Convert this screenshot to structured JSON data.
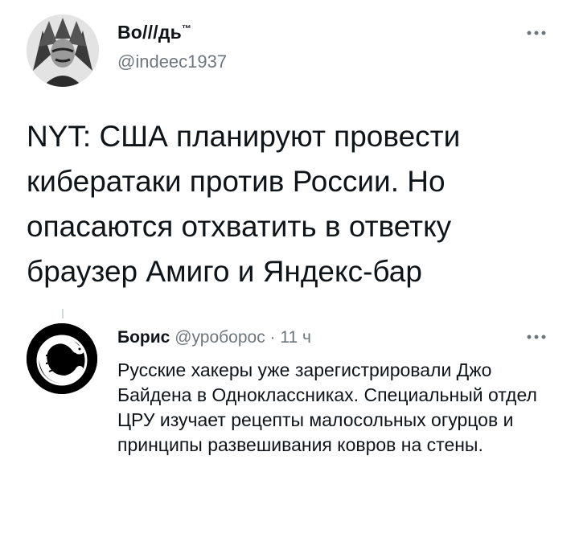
{
  "tweet": {
    "author_name": "Во///дь",
    "author_trademark": "™",
    "author_handle": "@indeec1937",
    "more_icon": "more-horizontal-icon",
    "text": "NYT: США планируют провести кибератаки против России. Но опасаются отхватить в ответку браузер Амиго и Яндекс-бар"
  },
  "reply": {
    "author_name": "Борис",
    "author_handle": "@уроборос",
    "separator": "·",
    "time": "11 ч",
    "more_icon": "more-horizontal-icon",
    "text": "Русские хакеры уже зарегистрировали Джо Байдена в Одноклассниках. Специальный отдел ЦРУ изучает рецепты малосольных огурцов и принципы развешивания ковров на стены."
  }
}
